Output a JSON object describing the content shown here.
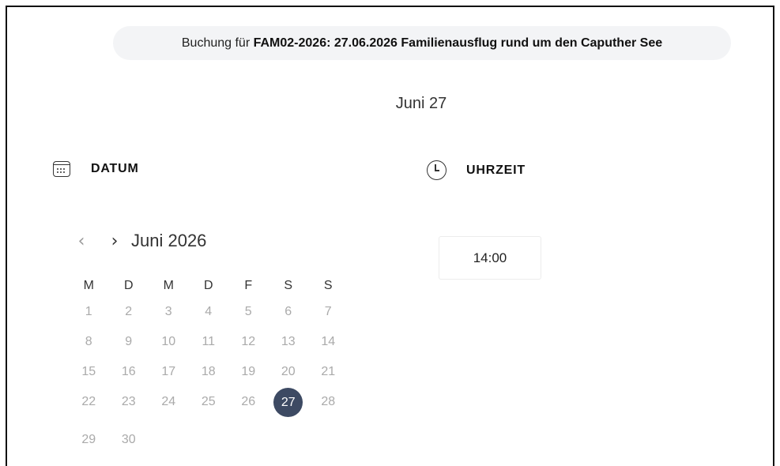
{
  "booking": {
    "prefix": "Buchung für",
    "title": "FAM02-2026: 27.06.2026 Familienausflug rund um den Caputher See"
  },
  "selected_date_title": "Juni 27",
  "sections": {
    "date_label": "DATUM",
    "time_label": "UHRZEIT"
  },
  "calendar": {
    "prev_icon": "chevron-left-icon",
    "next_icon": "chevron-right-icon",
    "prev_glyph": "‹",
    "next_glyph": "›",
    "month_label": "Juni 2026",
    "weekdays": [
      "M",
      "D",
      "M",
      "D",
      "F",
      "S",
      "S"
    ],
    "weeks": [
      [
        "1",
        "2",
        "3",
        "4",
        "5",
        "6",
        "7"
      ],
      [
        "8",
        "9",
        "10",
        "11",
        "12",
        "13",
        "14"
      ],
      [
        "15",
        "16",
        "17",
        "18",
        "19",
        "20",
        "21"
      ],
      [
        "22",
        "23",
        "24",
        "25",
        "26",
        "27",
        "28"
      ],
      [
        "29",
        "30",
        "",
        "",
        "",
        "",
        ""
      ]
    ],
    "selected_day": "27",
    "selected_color": "#3d4a63"
  },
  "time_slots": [
    "14:00"
  ]
}
